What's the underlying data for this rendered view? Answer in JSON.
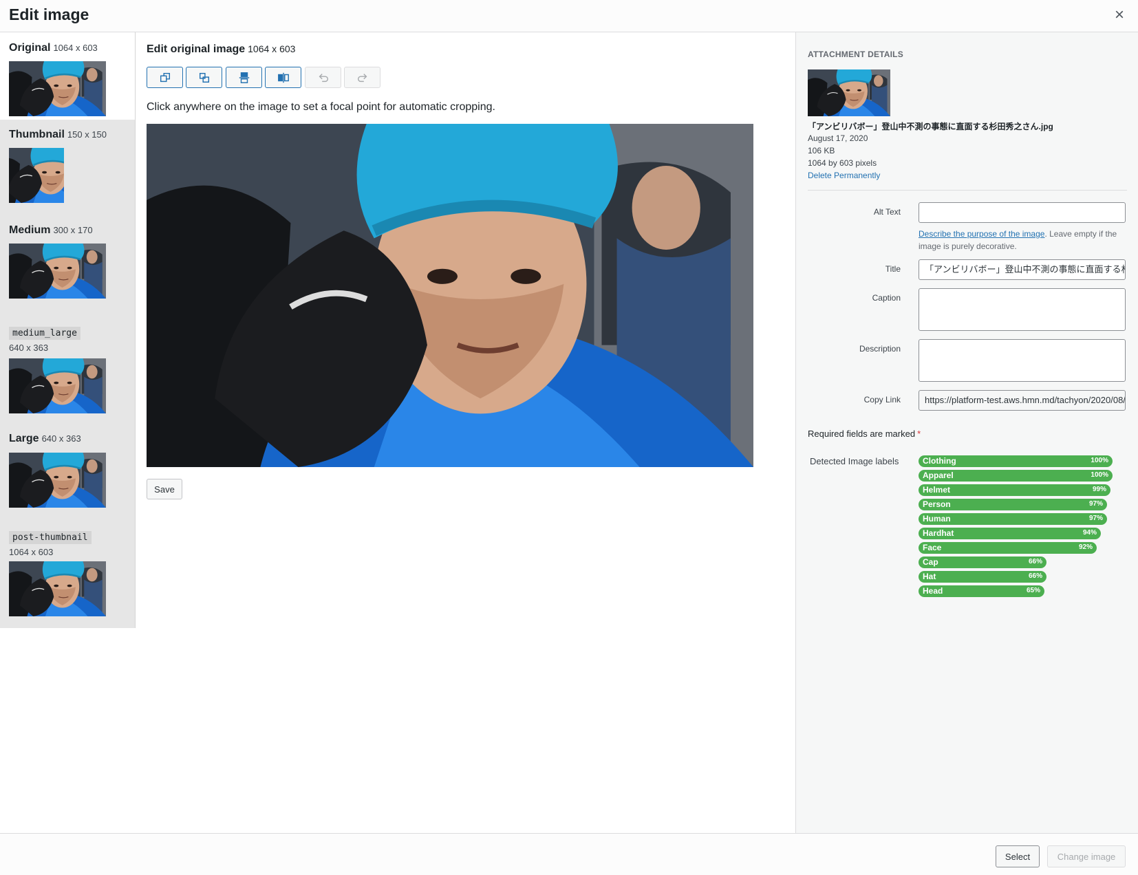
{
  "header": {
    "title": "Edit image",
    "close_label": "×"
  },
  "sizes": [
    {
      "name": "Original",
      "dim": "1064 x 603",
      "style": "bold"
    },
    {
      "name": "Thumbnail",
      "dim": "150 x 150",
      "style": "bold"
    },
    {
      "name": "Medium",
      "dim": "300 x 170",
      "style": "bold"
    },
    {
      "name": "medium_large",
      "dim": "640 x 363",
      "style": "code"
    },
    {
      "name": "Large",
      "dim": "640 x 363",
      "style": "bold"
    },
    {
      "name": "post-thumbnail",
      "dim": "1064 x 603",
      "style": "code"
    }
  ],
  "editor": {
    "title": "Edit original image",
    "dim": "1064 x 603",
    "toolbar": [
      {
        "name": "crop-icon",
        "enabled": true
      },
      {
        "name": "rotate-left-icon",
        "enabled": true
      },
      {
        "name": "flip-vertical-icon",
        "enabled": true
      },
      {
        "name": "flip-horizontal-icon",
        "enabled": true
      },
      {
        "name": "undo-icon",
        "enabled": false
      },
      {
        "name": "redo-icon",
        "enabled": false
      }
    ],
    "hint": "Click anywhere on the image to set a focal point for automatic cropping.",
    "save_label": "Save"
  },
  "details": {
    "heading": "Attachment Details",
    "filename": "「アンビリバボー」登山中不測の事態に直面する杉田秀之さん.jpg",
    "date": "August 17, 2020",
    "size": "106 KB",
    "dimensions": "1064 by 603 pixels",
    "delete_label": "Delete Permanently",
    "alt_label": "Alt Text",
    "alt_value": "",
    "alt_help_link": "Describe the purpose of the image",
    "alt_help_text": ". Leave empty if the image is purely decorative.",
    "title_label": "Title",
    "title_value": "「アンビリバボー」登山中不測の事態に直面する杉田秀之さん",
    "caption_label": "Caption",
    "caption_value": "",
    "description_label": "Description",
    "description_value": "",
    "copylink_label": "Copy Link",
    "copylink_value": "https://platform-test.aws.hmn.md/tachyon/2020/08/",
    "required_text": "Required fields are marked",
    "required_star": "*",
    "labels_title": "Detected Image labels",
    "labels": [
      {
        "label": "Clothing",
        "pct": "100%",
        "value": 100
      },
      {
        "label": "Apparel",
        "pct": "100%",
        "value": 100
      },
      {
        "label": "Helmet",
        "pct": "99%",
        "value": 99
      },
      {
        "label": "Person",
        "pct": "97%",
        "value": 97
      },
      {
        "label": "Human",
        "pct": "97%",
        "value": 97
      },
      {
        "label": "Hardhat",
        "pct": "94%",
        "value": 94
      },
      {
        "label": "Face",
        "pct": "92%",
        "value": 92
      },
      {
        "label": "Cap",
        "pct": "66%",
        "value": 66
      },
      {
        "label": "Hat",
        "pct": "66%",
        "value": 66
      },
      {
        "label": "Head",
        "pct": "65%",
        "value": 65
      }
    ],
    "label_color": "#4caf50"
  },
  "footer": {
    "select_label": "Select",
    "change_label": "Change image"
  }
}
